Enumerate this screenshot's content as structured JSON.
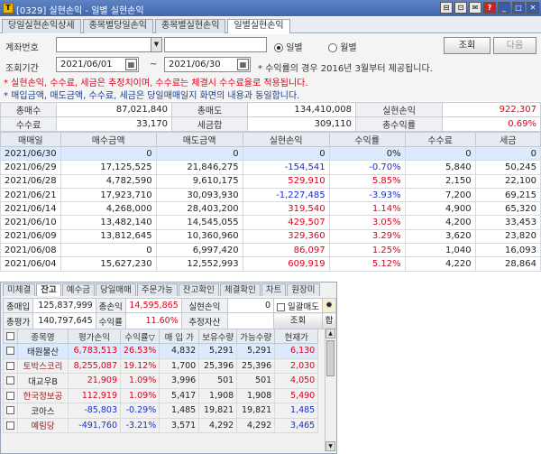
{
  "window": {
    "title": "[0329] 실현손익 - 일별 실현손익",
    "app_icon_label": "T",
    "controls": [
      "⊟",
      "⊡",
      "✉",
      "?",
      "_",
      "□",
      "✕"
    ]
  },
  "tabs": [
    {
      "label": "당일실현손익상세",
      "active": false
    },
    {
      "label": "종목별당일손익",
      "active": false
    },
    {
      "label": "종목별실현손익",
      "active": false
    },
    {
      "label": "일별실현손익",
      "active": true
    }
  ],
  "form": {
    "account_label": "계좌번호",
    "account_value": "",
    "account_name_value": "",
    "radio_daily": "일별",
    "radio_monthly": "월별",
    "search_button": "조회",
    "next_button": "다음",
    "period_label": "조회기간",
    "date_from": "2021/06/01",
    "tilde": "~",
    "date_to": "2021/06/30",
    "calendar_glyph": "▦",
    "notice_line1": "* 수익률의 경우 2016년 3월부터 제공됩니다.",
    "notice_line2": "* 실현손익, 수수료, 세금은 추정치이며, 수수료는 체결시 수수료율로 적용됩니다.",
    "notice_line3": "* 매입금액, 매도금액, 수수료, 세금은 당일매매일지 화면의 내용과 동일합니다."
  },
  "summary": {
    "rows": [
      [
        {
          "label": "총매수",
          "value": "87,021,840",
          "color": "normal"
        },
        {
          "label": "총매도",
          "value": "134,410,008",
          "color": "normal"
        },
        {
          "label": "실현손익",
          "value": "922,307",
          "color": "red"
        }
      ],
      [
        {
          "label": "수수료",
          "value": "33,170",
          "color": "normal"
        },
        {
          "label": "세금합",
          "value": "309,110",
          "color": "normal"
        },
        {
          "label": "총수익률",
          "value": "0.69%",
          "color": "red"
        }
      ]
    ]
  },
  "grid": {
    "headers": [
      "매매일",
      "매수금액",
      "매도금액",
      "실현손익",
      "수익률",
      "수수료",
      "세금"
    ],
    "rows": [
      {
        "date": "2021/06/30",
        "buy": "0",
        "sell": "0",
        "pnl": "0",
        "rate": "0%",
        "fee": "0",
        "tax": "0",
        "tone": "normal",
        "selected": true
      },
      {
        "date": "2021/06/29",
        "buy": "17,125,525",
        "sell": "21,846,275",
        "pnl": "-154,541",
        "rate": "-0.70%",
        "fee": "5,840",
        "tax": "50,245",
        "tone": "blue",
        "selected": false
      },
      {
        "date": "2021/06/28",
        "buy": "4,782,590",
        "sell": "9,610,175",
        "pnl": "529,910",
        "rate": "5.85%",
        "fee": "2,150",
        "tax": "22,100",
        "tone": "red",
        "selected": false
      },
      {
        "date": "2021/06/21",
        "buy": "17,923,710",
        "sell": "30,093,930",
        "pnl": "-1,227,485",
        "rate": "-3.93%",
        "fee": "7,200",
        "tax": "69,215",
        "tone": "blue",
        "selected": false
      },
      {
        "date": "2021/06/14",
        "buy": "4,268,000",
        "sell": "28,403,200",
        "pnl": "319,540",
        "rate": "1.14%",
        "fee": "4,900",
        "tax": "65,320",
        "tone": "red",
        "selected": false
      },
      {
        "date": "2021/06/10",
        "buy": "13,482,140",
        "sell": "14,545,055",
        "pnl": "429,507",
        "rate": "3.05%",
        "fee": "4,200",
        "tax": "33,453",
        "tone": "red",
        "selected": false
      },
      {
        "date": "2021/06/09",
        "buy": "13,812,645",
        "sell": "10,360,960",
        "pnl": "329,360",
        "rate": "3.29%",
        "fee": "3,620",
        "tax": "23,820",
        "tone": "red",
        "selected": false
      },
      {
        "date": "2021/06/08",
        "buy": "0",
        "sell": "6,997,420",
        "pnl": "86,097",
        "rate": "1.25%",
        "fee": "1,040",
        "tax": "16,093",
        "tone": "red",
        "selected": false
      },
      {
        "date": "2021/06/04",
        "buy": "15,627,230",
        "sell": "12,552,993",
        "pnl": "609,919",
        "rate": "5.12%",
        "fee": "4,220",
        "tax": "28,864",
        "tone": "red",
        "selected": false
      }
    ]
  },
  "lower": {
    "tabs": [
      {
        "label": "미체결",
        "active": false
      },
      {
        "label": "잔고",
        "active": true
      },
      {
        "label": "예수금",
        "active": false
      },
      {
        "label": "당일매매",
        "active": false
      },
      {
        "label": "주문가능",
        "active": false
      },
      {
        "label": "잔고확인",
        "active": false
      },
      {
        "label": "체결확인",
        "active": false
      },
      {
        "label": "차트",
        "active": false
      },
      {
        "label": "원장미",
        "active": false
      }
    ],
    "summary": {
      "total_buy_label": "총매입",
      "total_buy": "125,837,999",
      "total_pnl_label": "총손익",
      "total_pnl": "14,595,865",
      "realized_label": "실현손익",
      "realized": "0",
      "toggle_label": "일괄매도",
      "total_eval_label": "총평가",
      "total_eval": "140,797,645",
      "rate_label": "수익률",
      "rate": "11.60%",
      "est_label": "추정자산",
      "est": "",
      "search_button": "조회",
      "sum_button": "합"
    },
    "headers": [
      "종목명",
      "평가손익",
      "수익률▽",
      "매 입 가",
      "보유수량",
      "가능수량",
      "현재가"
    ],
    "rows": [
      {
        "name": "태원물산",
        "eval": "6,783,513",
        "rate": "26.53%",
        "price": "4,832",
        "qty": "5,291",
        "avail": "5,291",
        "cur": "6,130",
        "tone": "red",
        "name_tone": "normal",
        "selected": true
      },
      {
        "name": "토박스코리",
        "eval": "8,255,087",
        "rate": "19.12%",
        "price": "1,700",
        "qty": "25,396",
        "avail": "25,396",
        "cur": "2,030",
        "tone": "red",
        "name_tone": "maroon",
        "selected": false
      },
      {
        "name": "대교우B",
        "eval": "21,909",
        "rate": "1.09%",
        "price": "3,996",
        "qty": "501",
        "avail": "501",
        "cur": "4,050",
        "tone": "red",
        "name_tone": "normal",
        "selected": false
      },
      {
        "name": "한국정보공",
        "eval": "112,919",
        "rate": "1.09%",
        "price": "5,417",
        "qty": "1,908",
        "avail": "1,908",
        "cur": "5,490",
        "tone": "red",
        "name_tone": "maroon",
        "selected": false
      },
      {
        "name": "코아스",
        "eval": "-85,803",
        "rate": "-0.29%",
        "price": "1,485",
        "qty": "19,821",
        "avail": "19,821",
        "cur": "1,485",
        "tone": "blue",
        "name_tone": "normal",
        "selected": false
      },
      {
        "name": "예림당",
        "eval": "-491,760",
        "rate": "-3.21%",
        "price": "3,571",
        "qty": "4,292",
        "avail": "4,292",
        "cur": "3,465",
        "tone": "blue",
        "name_tone": "maroon",
        "selected": false
      }
    ]
  },
  "colors": {
    "red": "#e0001b",
    "blue": "#1a2fd0",
    "maroon": "#9b1c1c",
    "title_bar": "#4a6fb5"
  }
}
